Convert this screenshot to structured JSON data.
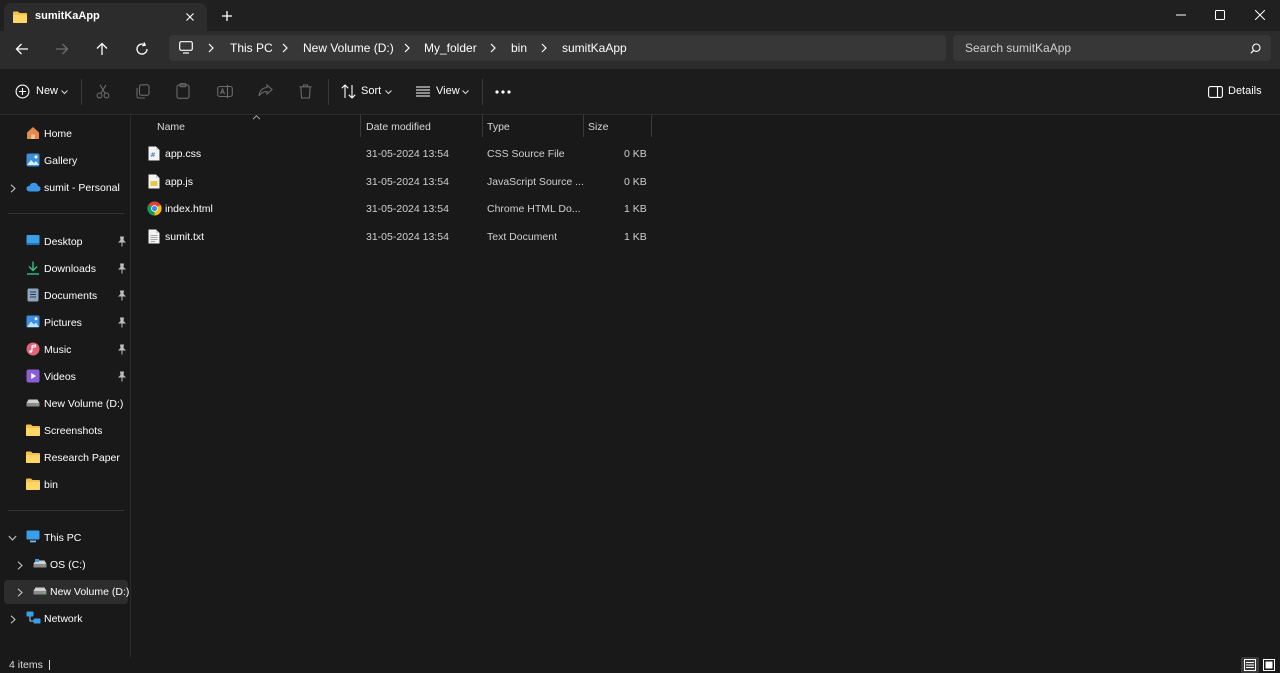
{
  "window": {
    "tab_title": "sumitKaApp"
  },
  "address": {
    "crumbs": [
      "This PC",
      "New Volume (D:)",
      "My_folder",
      "bin",
      "sumitKaApp"
    ],
    "search_placeholder": "Search sumitKaApp"
  },
  "toolbar": {
    "new_label": "New",
    "sort_label": "Sort",
    "view_label": "View",
    "details_label": "Details"
  },
  "sidebar": {
    "top": [
      {
        "label": "Home",
        "icon": "home-icon"
      },
      {
        "label": "Gallery",
        "icon": "gallery-icon"
      },
      {
        "label": "sumit - Personal",
        "icon": "cloud-icon"
      }
    ],
    "quick": [
      {
        "label": "Desktop",
        "icon": "desktop-icon",
        "pinned": true
      },
      {
        "label": "Downloads",
        "icon": "downloads-icon",
        "pinned": true
      },
      {
        "label": "Documents",
        "icon": "documents-icon",
        "pinned": true
      },
      {
        "label": "Pictures",
        "icon": "pictures-icon",
        "pinned": true
      },
      {
        "label": "Music",
        "icon": "music-icon",
        "pinned": true
      },
      {
        "label": "Videos",
        "icon": "videos-icon",
        "pinned": true
      },
      {
        "label": "New Volume (D:)",
        "icon": "drive-icon"
      },
      {
        "label": "Screenshots",
        "icon": "folder-icon"
      },
      {
        "label": "Research Paper",
        "icon": "folder-icon"
      },
      {
        "label": "bin",
        "icon": "folder-icon"
      }
    ],
    "tree": [
      {
        "label": "This PC",
        "icon": "pc-icon"
      },
      {
        "label": "OS (C:)",
        "icon": "drive-icon"
      },
      {
        "label": "New Volume (D:)",
        "icon": "drive-icon",
        "selected": true
      },
      {
        "label": "Network",
        "icon": "network-icon"
      }
    ]
  },
  "columns": {
    "name": "Name",
    "date": "Date modified",
    "type": "Type",
    "size": "Size"
  },
  "files": [
    {
      "name": "app.css",
      "date": "31-05-2024 13:54",
      "type": "CSS Source File",
      "size": "0 KB",
      "icon": "css-file-icon"
    },
    {
      "name": "app.js",
      "date": "31-05-2024 13:54",
      "type": "JavaScript Source ...",
      "size": "0 KB",
      "icon": "js-file-icon"
    },
    {
      "name": "index.html",
      "date": "31-05-2024 13:54",
      "type": "Chrome HTML Do...",
      "size": "1 KB",
      "icon": "chrome-icon"
    },
    {
      "name": "sumit.txt",
      "date": "31-05-2024 13:54",
      "type": "Text Document",
      "size": "1 KB",
      "icon": "text-file-icon"
    }
  ],
  "status": {
    "item_count": "4 items"
  },
  "colors": {
    "folder": "#f2c14e",
    "accent_blue": "#4aa3f0"
  }
}
